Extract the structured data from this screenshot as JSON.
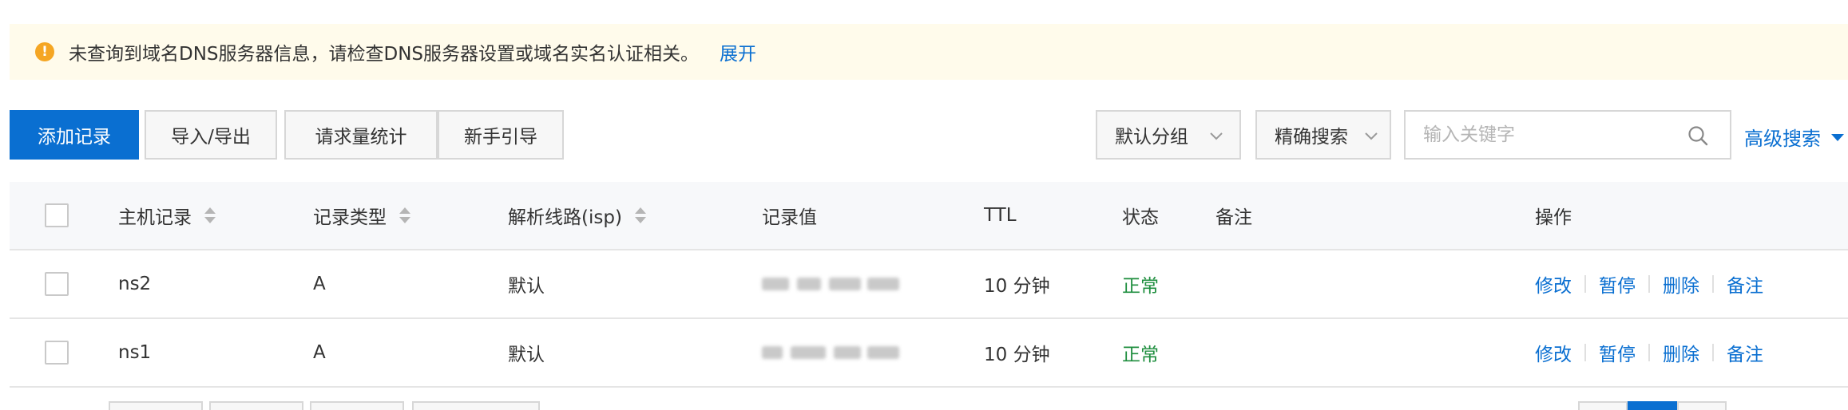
{
  "notice": {
    "icon": "warning-icon",
    "text": "未查询到域名DNS服务器信息，请检查DNS服务器设置或域名实名认证相关。",
    "link": "展开",
    "color": "#f5a623"
  },
  "toolbar": {
    "add_record": "添加记录",
    "import_export": "导入/导出",
    "request_stats": "请求量统计",
    "beginner_guide": "新手引导",
    "group_select": "默认分组",
    "search_mode": "精确搜索",
    "search_placeholder": "输入关键字",
    "advanced_search": "高级搜索"
  },
  "table": {
    "columns": {
      "host": "主机记录",
      "type": "记录类型",
      "line": "解析线路(isp)",
      "value": "记录值",
      "ttl": "TTL",
      "status": "状态",
      "remark": "备注",
      "actions": "操作"
    },
    "rows": [
      {
        "host": "ns2",
        "type": "A",
        "line": "默认",
        "ttl": "10 分钟",
        "status": "正常"
      },
      {
        "host": "ns1",
        "type": "A",
        "line": "默认",
        "ttl": "10 分钟",
        "status": "正常"
      }
    ],
    "actions": {
      "edit": "修改",
      "pause": "暂停",
      "delete": "删除",
      "remark": "备注"
    }
  },
  "colors": {
    "primary": "#0a6fd1",
    "status_ok": "#1e8e3e",
    "notice_bg": "#fffbeb"
  }
}
